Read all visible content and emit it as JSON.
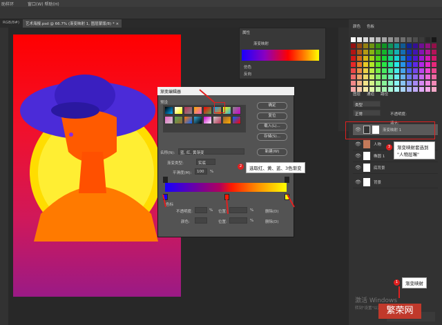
{
  "menubar": {
    "left_label": "助样环",
    "menu_label": "窗口(W)   帮助(H)"
  },
  "document_tabs": [
    {
      "label": "RGB/8#)"
    },
    {
      "label": "艺术海报.psd @ 66.7% (渐变映射 1, 图层蒙版/8) * ×"
    }
  ],
  "properties_panel": {
    "title": "属性",
    "subtitle": "渐变映射",
    "options": [
      "仿色",
      "反向"
    ]
  },
  "color_panel": {
    "tabs": [
      "颜色",
      "色板"
    ]
  },
  "gradient_editor": {
    "title": "渐变编辑器",
    "presets_label": "预设",
    "buttons": [
      "确定",
      "复位",
      "载入(L)...",
      "存储(S)..."
    ],
    "name_label": "名称(N):",
    "name_value": "蓝, 红, 黄渐变",
    "new_button": "新建(W)",
    "type_label": "渐变类型:",
    "type_value": "实底",
    "smooth_label": "平滑度(M):",
    "smooth_value": "100",
    "smooth_unit": "%",
    "stops_label": "色标",
    "opacity_label": "不透明度:",
    "location_label": "位置:",
    "delete_label": "删除(D)",
    "color_label": "颜色:",
    "percent": "%"
  },
  "layers_panel": {
    "tabs": [
      "图层",
      "通道",
      "路径"
    ],
    "filter_label": "类型",
    "blend_mode": "正常",
    "opacity_label": "不透明度:",
    "fill_label": "填充:",
    "layers": [
      {
        "name": "渐变映射 1"
      },
      {
        "name": "人物"
      },
      {
        "name": "椭圆 1"
      },
      {
        "name": "底背景"
      },
      {
        "name": "背景"
      }
    ]
  },
  "annotations": {
    "step1": {
      "number": "1",
      "text": "渐变映射"
    },
    "step2": {
      "number": "2",
      "text": "选取红、黄、蓝、3色渐变"
    },
    "step3": {
      "number": "3",
      "text": "渐变映射套选到\n\"人物层嘴\""
    }
  },
  "watermark": {
    "windows": "激活 Windows",
    "windows_sub": "转到\"设置\"以激活",
    "site": "繁荣网"
  }
}
